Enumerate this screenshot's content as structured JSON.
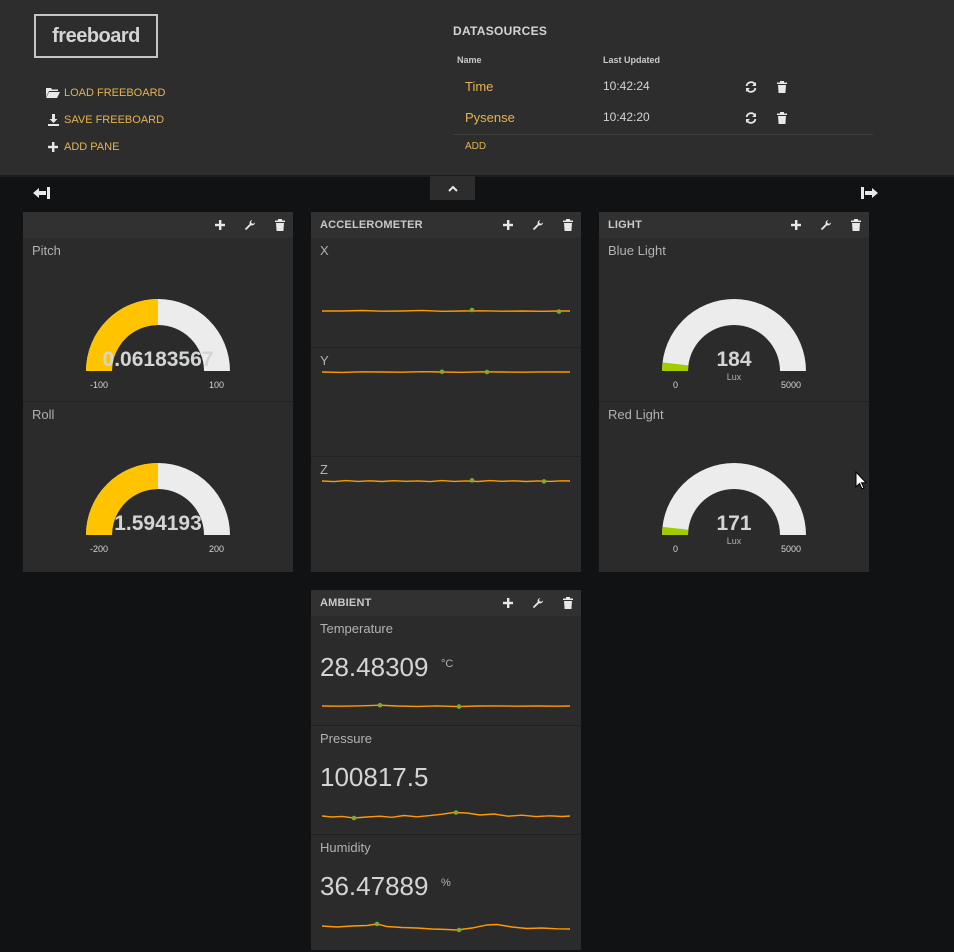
{
  "app": {
    "logo": "freeboard"
  },
  "menu": {
    "load": "LOAD FREEBOARD",
    "save": "SAVE FREEBOARD",
    "add_pane": "ADD PANE"
  },
  "datasources": {
    "title": "DATASOURCES",
    "col_name": "Name",
    "col_updated": "Last Updated",
    "rows": [
      {
        "name": "Time",
        "updated": "10:42:24"
      },
      {
        "name": "Pysense",
        "updated": "10:42:20"
      }
    ],
    "add": "ADD"
  },
  "panes": {
    "p1": {
      "title": "",
      "widgets": [
        {
          "title": "Pitch",
          "value": "0.06183567",
          "min": "-100",
          "max": "100",
          "fraction": 0.5
        },
        {
          "title": "Roll",
          "value": "1.594193",
          "min": "-200",
          "max": "200",
          "fraction": 0.5
        }
      ]
    },
    "accel": {
      "title": "ACCELEROMETER",
      "widgets": [
        {
          "title": "X"
        },
        {
          "title": "Y"
        },
        {
          "title": "Z"
        }
      ]
    },
    "light": {
      "title": "LIGHT",
      "widgets": [
        {
          "title": "Blue Light",
          "value": "184",
          "units": "Lux",
          "min": "0",
          "max": "5000",
          "fraction": 0.0368
        },
        {
          "title": "Red Light",
          "value": "171",
          "units": "Lux",
          "min": "0",
          "max": "5000",
          "fraction": 0.0342
        }
      ]
    },
    "ambient": {
      "title": "AMBIENT",
      "widgets": [
        {
          "title": "Temperature",
          "value": "28.48309",
          "units": "°C"
        },
        {
          "title": "Pressure",
          "value": "100817.5",
          "units": ""
        },
        {
          "title": "Humidity",
          "value": "36.47889",
          "units": "%"
        }
      ]
    }
  },
  "colors": {
    "accent": "#e5b350",
    "gauge_yellow": "#ffc300",
    "gauge_green": "#a0cc00",
    "gauge_bg": "#ececec",
    "spark": "#ff9900",
    "spark_dot": "#7fa830"
  },
  "icons": [
    "folder-open-icon",
    "download-icon",
    "plus-icon",
    "refresh-icon",
    "trash-icon",
    "wrench-icon",
    "chevron-up-icon",
    "column-left-icon",
    "column-right-icon"
  ]
}
